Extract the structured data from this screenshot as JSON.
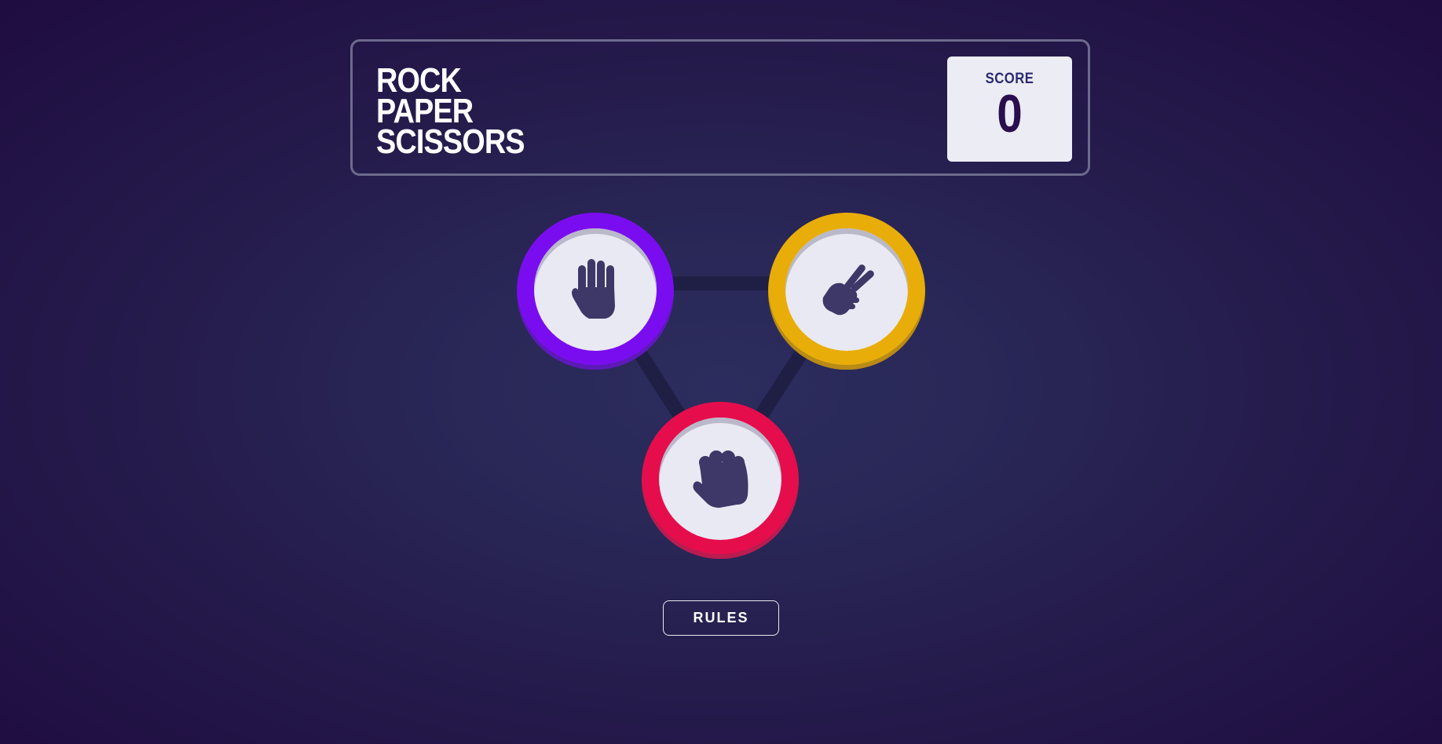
{
  "header": {
    "title_lines": [
      "ROCK",
      "PAPER",
      "SCISSORS"
    ],
    "score_label": "SCORE",
    "score_value": "0"
  },
  "choices": [
    {
      "name": "paper",
      "icon": "paper-hand-icon",
      "ring_color": "#7a0df0"
    },
    {
      "name": "scissors",
      "icon": "scissors-hand-icon",
      "ring_color": "#e8ad08"
    },
    {
      "name": "rock",
      "icon": "rock-fist-icon",
      "ring_color": "#e60d4c"
    }
  ],
  "rules_button": {
    "label": "RULES"
  },
  "colors": {
    "background": "#251c4c",
    "icon": "#3d3867",
    "score_text": "#2a0f4f",
    "triangle_line": "#1c1b3e"
  }
}
